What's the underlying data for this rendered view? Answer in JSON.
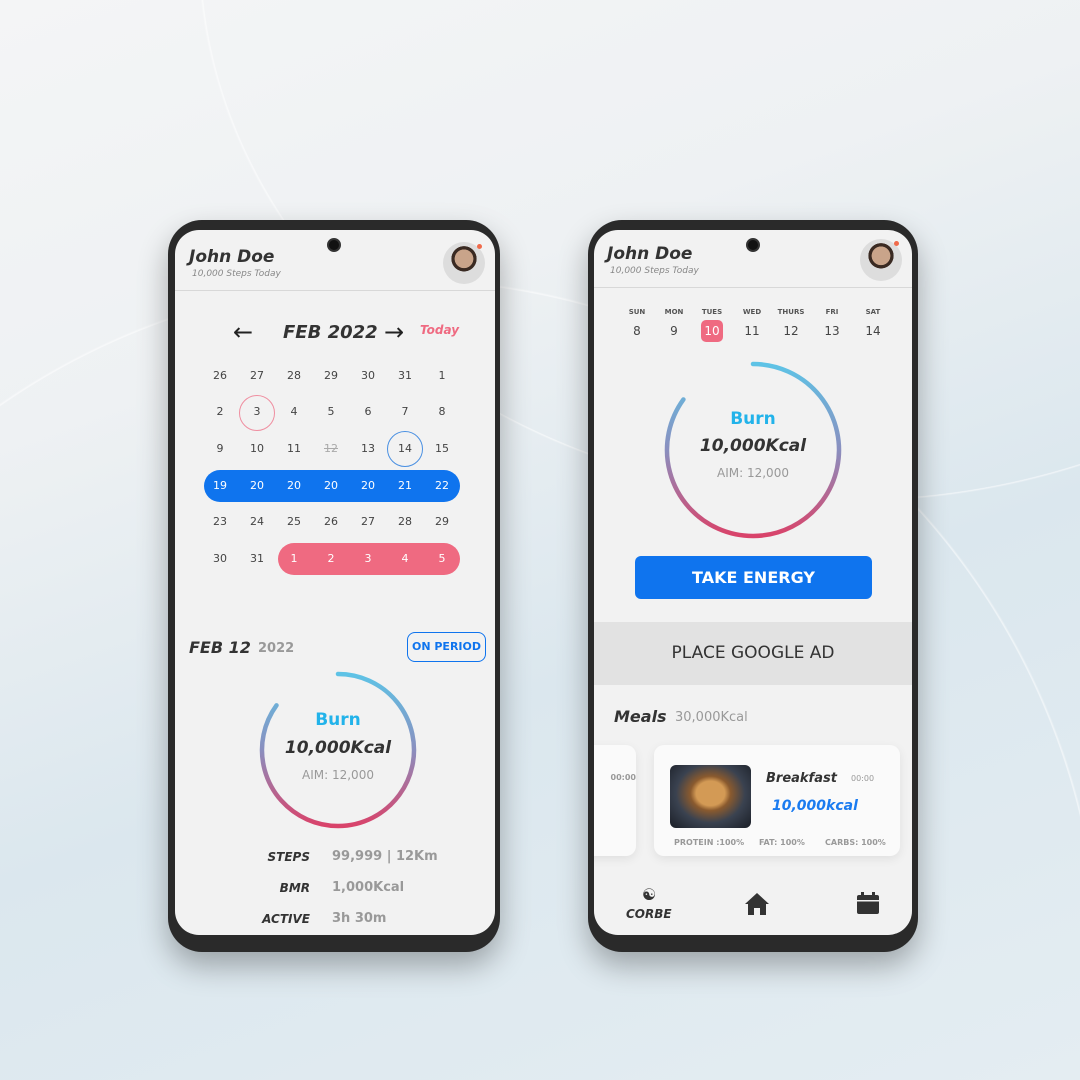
{
  "colors": {
    "accent_blue": "#0f74ee",
    "accent_pink": "#ef6a81",
    "burn_cyan": "#22b3ea"
  },
  "profile": {
    "name": "John Doe",
    "subtitle": "10,000 Steps Today"
  },
  "calendar": {
    "month": "FEB 2022",
    "today_label": "Today",
    "prev_icon": "arrow-left-icon",
    "next_icon": "arrow-right-icon",
    "rows": [
      [
        "26",
        "27",
        "28",
        "29",
        "30",
        "31",
        "1"
      ],
      [
        "2",
        "3",
        "4",
        "5",
        "6",
        "7",
        "8"
      ],
      [
        "9",
        "10",
        "11",
        "12",
        "13",
        "14",
        "15"
      ],
      [
        "19",
        "20",
        "20",
        "20",
        "20",
        "21",
        "22"
      ],
      [
        "23",
        "24",
        "25",
        "26",
        "27",
        "28",
        "29"
      ],
      [
        "30",
        "31",
        "1",
        "2",
        "3",
        "4",
        "5"
      ]
    ]
  },
  "day_detail": {
    "date": "FEB 12",
    "year": "2022",
    "badge": "ON PERIOD"
  },
  "burn": {
    "label": "Burn",
    "value": "10,000Kcal",
    "aim": "AIM: 12,000",
    "progress_fraction": 0.85
  },
  "stats": [
    {
      "label": "STEPS",
      "value": "99,999 | 12Km"
    },
    {
      "label": "BMR",
      "value": "1,000Kcal"
    },
    {
      "label": "ACTIVE",
      "value": "3h 30m"
    }
  ],
  "week": {
    "days": [
      "SUN",
      "MON",
      "TUES",
      "WED",
      "THURS",
      "FRI",
      "SAT"
    ],
    "dates": [
      "8",
      "9",
      "10",
      "11",
      "12",
      "13",
      "14"
    ],
    "selected_index": 2
  },
  "take_energy": "TAKE ENERGY",
  "ad": "PLACE GOOGLE AD",
  "meals": {
    "title": "Meals",
    "total": "30,000Kcal",
    "partial_time": "00:00",
    "card": {
      "name": "Breakfast",
      "time": "00:00",
      "kcal": "10,000kcal",
      "protein": "PROTEIN :100%",
      "fat": "FAT: 100%",
      "carbs": "CARBS: 100%"
    }
  },
  "nav": {
    "brand": "CORBE",
    "brand_icon": "corbe-logo-icon",
    "home_icon": "home-icon",
    "calendar_icon": "calendar-icon"
  }
}
